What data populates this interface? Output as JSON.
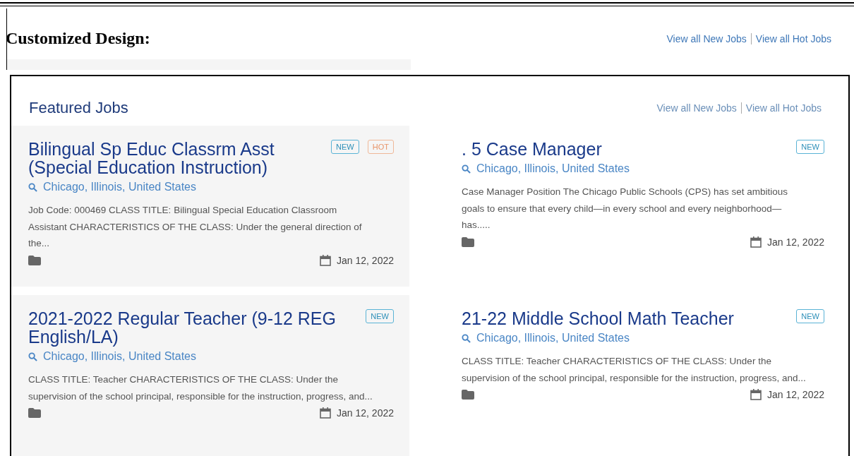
{
  "page_heading": "Customized Design:",
  "top_links": [
    "View all New Jobs",
    "View all Hot Jobs"
  ],
  "section": {
    "title": "Featured Jobs",
    "links": [
      "View all New Jobs",
      "View all Hot Jobs"
    ]
  },
  "jobs": [
    {
      "title": "Bilingual Sp Educ Classrm Asst (Special Education Instruction)",
      "tags": [
        {
          "kind": "new",
          "label": "NEW"
        },
        {
          "kind": "hot",
          "label": "HOT"
        }
      ],
      "location": "Chicago, Illinois, United States",
      "description": "Job Code: 000469 CLASS TITLE: Bilingual Special Education Classroom Assistant CHARACTERISTICS OF THE CLASS: Under the general direction of the...",
      "date": "Jan 12, 2022"
    },
    {
      "title": ". 5 Case Manager",
      "tags": [
        {
          "kind": "new",
          "label": "NEW"
        }
      ],
      "location": "Chicago, Illinois, United States",
      "description": "Case Manager Position The Chicago Public Schools (CPS) has set ambitious goals to ensure that every child—in every school and every neighborhood—has.....",
      "date": "Jan 12, 2022"
    },
    {
      "title": "2021-2022 Regular Teacher (9-12 REG English/LA)",
      "tags": [
        {
          "kind": "new",
          "label": "NEW"
        }
      ],
      "location": "Chicago, Illinois, United States",
      "description": "CLASS TITLE: Teacher CHARACTERISTICS OF THE CLASS: Under the supervision of the school principal, responsible for the instruction, progress, and...",
      "date": "Jan 12, 2022"
    },
    {
      "title": "21-22 Middle School Math Teacher",
      "tags": [
        {
          "kind": "new",
          "label": "NEW"
        }
      ],
      "location": "Chicago, Illinois, United States",
      "description": "CLASS TITLE: Teacher CHARACTERISTICS OF THE CLASS: Under the supervision of the school principal, responsible for the instruction, progress, and...",
      "date": "Jan 12, 2022"
    }
  ]
}
